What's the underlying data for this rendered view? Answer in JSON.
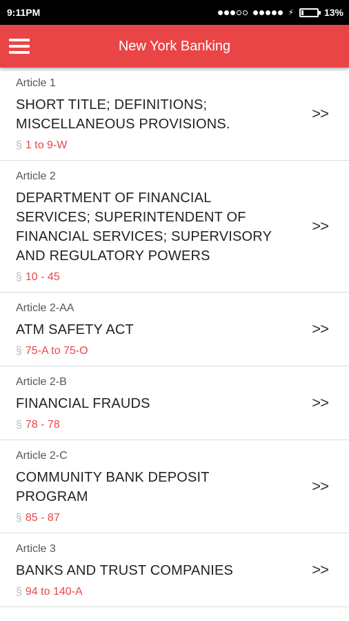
{
  "status_bar": {
    "time": "9:11PM",
    "battery": "13%",
    "battery_level": 0.13
  },
  "app_bar": {
    "title": "New York Banking",
    "menu_icon": "hamburger-menu-icon"
  },
  "section_symbol": "§",
  "chevron": ">>",
  "articles": [
    {
      "article": "Article 1",
      "title": "SHORT TITLE; DEFINITIONS; MISCELLANEOUS PROVISIONS.",
      "range": "1 to 9-W"
    },
    {
      "article": "Article 2",
      "title": "DEPARTMENT OF FINANCIAL SERVICES; SUPERINTENDENT OF FINANCIAL SERVICES; SUPERVISORY AND REGULATORY POWERS",
      "range": "10 - 45"
    },
    {
      "article": "Article 2-AA",
      "title": "ATM SAFETY ACT",
      "range": "75-A to 75-O"
    },
    {
      "article": "Article 2-B",
      "title": "FINANCIAL FRAUDS",
      "range": "78 - 78"
    },
    {
      "article": "Article 2-C",
      "title": "COMMUNITY BANK DEPOSIT PROGRAM",
      "range": "85 - 87"
    },
    {
      "article": "Article 3",
      "title": "BANKS AND TRUST COMPANIES",
      "range": "94 to 140-A"
    }
  ]
}
